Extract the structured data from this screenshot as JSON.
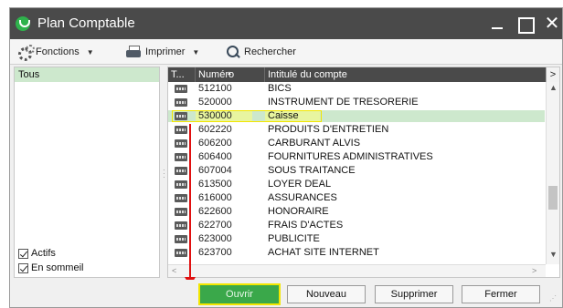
{
  "window": {
    "title": "Plan Comptable",
    "close_glyph": "✕",
    "accent_color": "#2fb24c",
    "titlebar_color": "#4a4a4a"
  },
  "toolbar": {
    "fonctions_label": "Fonctions",
    "imprimer_label": "Imprimer",
    "rechercher_label": "Rechercher",
    "icons": [
      "gear-icon",
      "printer-icon",
      "search-icon"
    ]
  },
  "left_panel": {
    "filter_item": "Tous",
    "checkboxes": [
      {
        "label": "Actifs",
        "checked": true
      },
      {
        "label": "En sommeil",
        "checked": true
      }
    ]
  },
  "grid": {
    "columns": [
      "T...",
      "Numéro",
      "Intitulé du compte"
    ],
    "more_glyph": ">",
    "selected_row_color": "#e8f5a0",
    "rows": [
      {
        "numero": "512100",
        "intitule": "BICS",
        "selected": false
      },
      {
        "numero": "520000",
        "intitule": "INSTRUMENT DE TRESORERIE",
        "selected": false
      },
      {
        "numero": "530000",
        "intitule": "Caisse",
        "selected": true
      },
      {
        "numero": "602220",
        "intitule": "PRODUITS D'ENTRETIEN",
        "selected": false
      },
      {
        "numero": "606200",
        "intitule": "CARBURANT ALVIS",
        "selected": false
      },
      {
        "numero": "606400",
        "intitule": "FOURNITURES ADMINISTRATIVES",
        "selected": false
      },
      {
        "numero": "607004",
        "intitule": "SOUS TRAITANCE",
        "selected": false
      },
      {
        "numero": "613500",
        "intitule": "LOYER DEAL",
        "selected": false
      },
      {
        "numero": "616000",
        "intitule": "ASSURANCES",
        "selected": false
      },
      {
        "numero": "622600",
        "intitule": "HONORAIRE",
        "selected": false
      },
      {
        "numero": "622700",
        "intitule": "FRAIS D'ACTES",
        "selected": false
      },
      {
        "numero": "623000",
        "intitule": "PUBLICITE",
        "selected": false
      },
      {
        "numero": "623700",
        "intitule": "ACHAT SITE INTERNET",
        "selected": false
      }
    ]
  },
  "footer": {
    "ouvrir_label": "Ouvrir",
    "nouveau_label": "Nouveau",
    "supprimer_label": "Supprimer",
    "fermer_label": "Fermer",
    "highlight_color": "#f2e600",
    "annotation_arrow_color": "#e01010"
  }
}
